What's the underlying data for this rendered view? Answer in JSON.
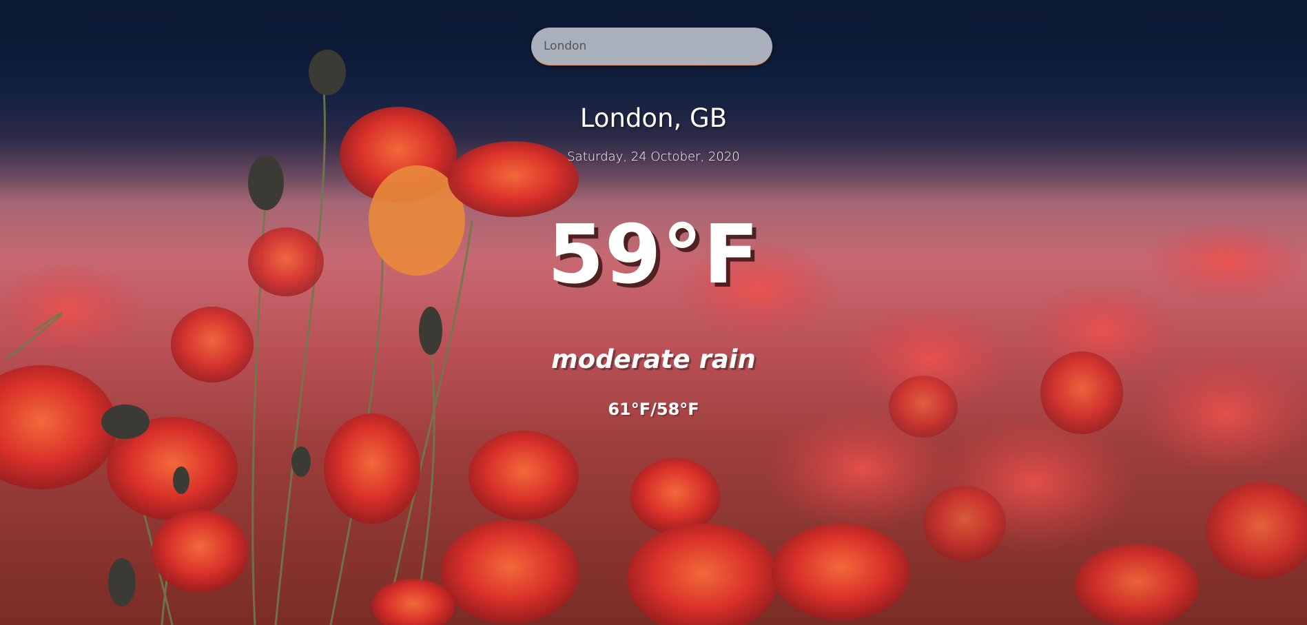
{
  "search": {
    "placeholder": "London",
    "value": ""
  },
  "weather": {
    "location": "London, GB",
    "date": "Saturday, 24 October, 2020",
    "temperature": "59°F",
    "description": "moderate rain",
    "high_low": "61°F/58°F"
  },
  "background": {
    "subject": "poppy-field-photo",
    "accent_color": "#e39a5e"
  }
}
